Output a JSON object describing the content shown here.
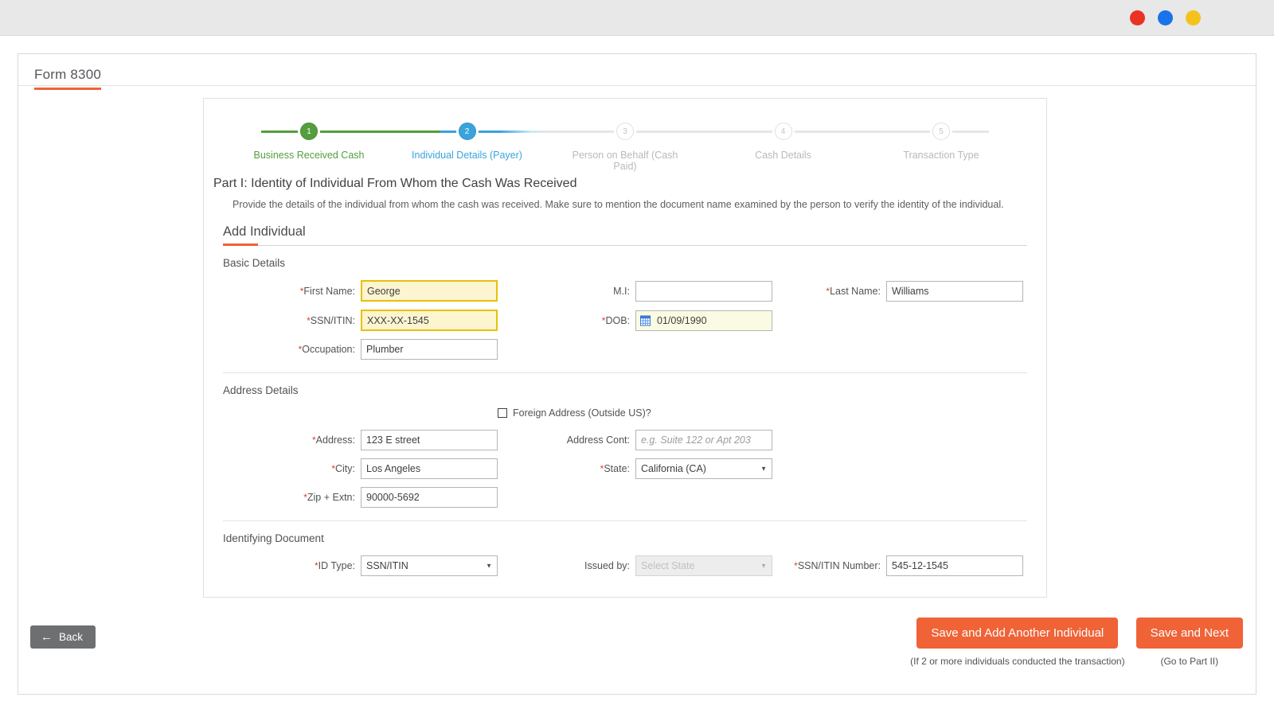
{
  "window": {
    "dots": [
      {
        "name": "close-dot",
        "color": "#ea3323"
      },
      {
        "name": "minimize-dot",
        "color": "#1a73e8"
      },
      {
        "name": "maximize-dot",
        "color": "#f5c21b"
      }
    ]
  },
  "page": {
    "title": "Form 8300",
    "accent": "#ef6337"
  },
  "stepper": {
    "steps": [
      {
        "number": "1",
        "label": "Business Received Cash",
        "state": "done"
      },
      {
        "number": "2",
        "label": "Individual Details (Payer)",
        "state": "active"
      },
      {
        "number": "3",
        "label": "Person on Behalf (Cash Paid)",
        "state": "todo"
      },
      {
        "number": "4",
        "label": "Cash Details",
        "state": "todo"
      },
      {
        "number": "5",
        "label": "Transaction Type",
        "state": "todo"
      }
    ],
    "done_color": "#539e3e",
    "active_color": "#3aa3dc",
    "todo_color": "#b7babd"
  },
  "part": {
    "title": "Part I: Identity of Individual From Whom the Cash Was Received",
    "description": "Provide the details of the individual from whom the cash was received. Make sure to mention the document name examined by the person to verify the identity of the individual.",
    "sub_head": "Add Individual"
  },
  "basic_details": {
    "section_title": "Basic Details",
    "first_name": {
      "label": "First Name:",
      "value": "George",
      "required": true,
      "highlighted": true
    },
    "mi": {
      "label": "M.I:",
      "value": "",
      "required": false
    },
    "last_name": {
      "label": "Last Name:",
      "value": "Williams",
      "required": true
    },
    "ssn_itin": {
      "label": "SSN/ITIN:",
      "value": "XXX-XX-1545",
      "required": true,
      "highlighted": true
    },
    "dob": {
      "label": "DOB:",
      "value": "01/09/1990",
      "required": true,
      "icon": "calendar-icon"
    },
    "occupation": {
      "label": "Occupation:",
      "value": "Plumber",
      "required": true
    }
  },
  "address_details": {
    "section_title": "Address Details",
    "foreign_address": {
      "label": "Foreign Address (Outside US)?",
      "checked": false
    },
    "address": {
      "label": "Address:",
      "value": "123 E street",
      "required": true
    },
    "address_cont": {
      "label": "Address Cont:",
      "value": "",
      "placeholder": "e.g. Suite 122 or Apt 203",
      "required": false
    },
    "city": {
      "label": "City:",
      "value": "Los Angeles",
      "required": true
    },
    "state": {
      "label": "State:",
      "value": "California (CA)",
      "required": true,
      "options": [
        "California (CA)"
      ]
    },
    "zip": {
      "label": "Zip + Extn:",
      "value": "90000-5692",
      "required": true
    }
  },
  "identifying_document": {
    "section_title": "Identifying Document",
    "id_type": {
      "label": "ID Type:",
      "value": "SSN/ITIN",
      "required": true,
      "options": [
        "SSN/ITIN"
      ]
    },
    "issued_by": {
      "label": "Issued by:",
      "value": "Select State",
      "required": false,
      "disabled": true,
      "options": [
        "Select State"
      ]
    },
    "ssn_itin_number": {
      "label": "SSN/ITIN Number:",
      "value": "545-12-1545",
      "required": true
    }
  },
  "footer": {
    "back_label": "Back",
    "save_add_another_label": "Save and Add Another Individual",
    "save_add_another_note": "(If 2 or more individuals conducted the transaction)",
    "save_next_label": "Save and Next",
    "save_next_note": "(Go to Part II)"
  }
}
